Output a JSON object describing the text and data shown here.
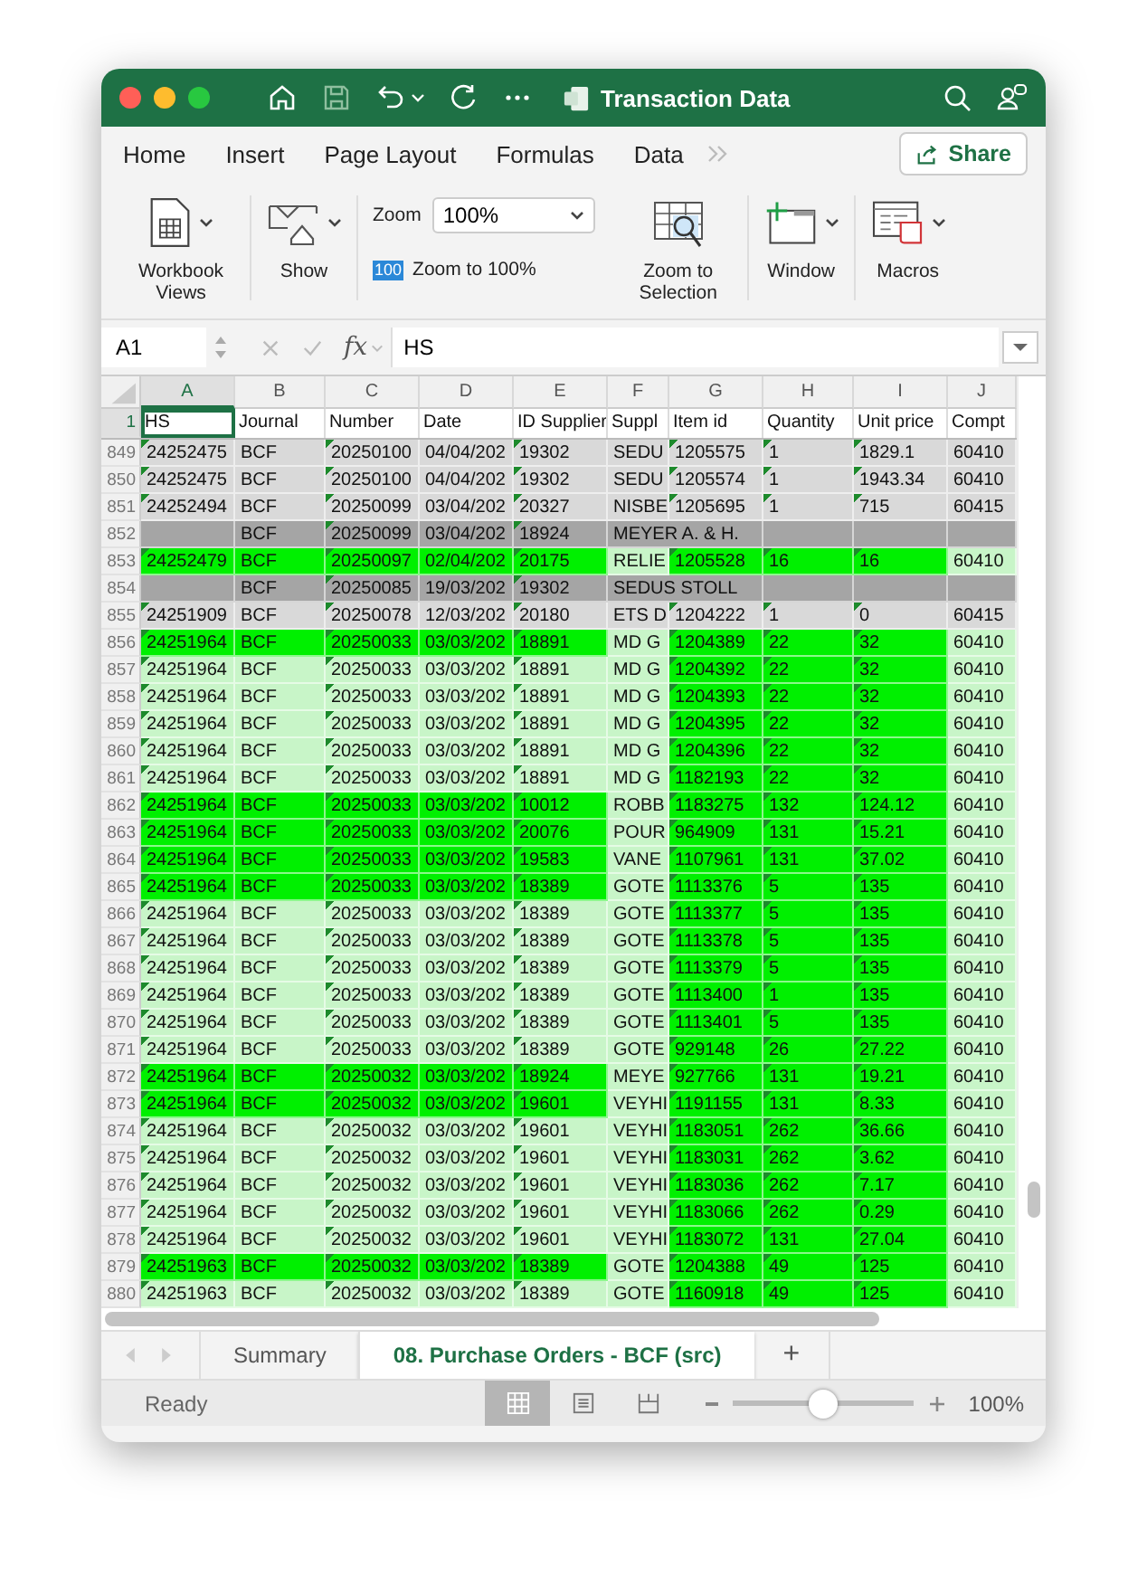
{
  "window": {
    "title": "Transaction Data"
  },
  "ribbon_tabs": [
    {
      "label": "Home"
    },
    {
      "label": "Insert"
    },
    {
      "label": "Page Layout"
    },
    {
      "label": "Formulas"
    },
    {
      "label": "Data"
    }
  ],
  "share_button": "Share",
  "ribbon": {
    "workbook_views": "Workbook Views",
    "show": "Show",
    "zoom_label": "Zoom",
    "zoom_value": "100%",
    "zoom_100_badge": "100",
    "zoom_100": "Zoom to 100%",
    "zoom_selection": "Zoom to Selection",
    "window": "Window",
    "macros": "Macros"
  },
  "formula_bar": {
    "name_box": "A1",
    "fx": "fx",
    "formula": "HS"
  },
  "columns": [
    {
      "letter": "A",
      "heading": "HS",
      "selected": true,
      "flagged": true
    },
    {
      "letter": "B",
      "heading": "Journal",
      "selected": false,
      "flagged": false
    },
    {
      "letter": "C",
      "heading": "Number",
      "selected": false,
      "flagged": true
    },
    {
      "letter": "D",
      "heading": "Date",
      "selected": false,
      "flagged": false
    },
    {
      "letter": "E",
      "heading": "ID Supplier",
      "selected": false,
      "flagged": true
    },
    {
      "letter": "F",
      "heading": "Suppl",
      "selected": false,
      "flagged": false
    },
    {
      "letter": "G",
      "heading": "Item id",
      "selected": false,
      "flagged": true
    },
    {
      "letter": "H",
      "heading": "Quantity",
      "selected": false,
      "flagged": true
    },
    {
      "letter": "I",
      "heading": "Unit price",
      "selected": false,
      "flagged": true
    },
    {
      "letter": "J",
      "heading": "Compt",
      "selected": false,
      "flagged": false
    }
  ],
  "header_row": {
    "number": "1",
    "selected": true
  },
  "rows": [
    {
      "number": "849",
      "kind": "gray",
      "cells": [
        "24252475",
        "BCF",
        "20250100",
        "04/04/202",
        "19302",
        "SEDU",
        "1205575",
        "1",
        "1829.1",
        "60410"
      ]
    },
    {
      "number": "850",
      "kind": "gray",
      "cells": [
        "24252475",
        "BCF",
        "20250100",
        "04/04/202",
        "19302",
        "SEDU",
        "1205574",
        "1",
        "1943.34",
        "60410"
      ]
    },
    {
      "number": "851",
      "kind": "gray",
      "cells": [
        "24252494",
        "BCF",
        "20250099",
        "03/04/202",
        "20327",
        "NISBE",
        "1205695",
        "1",
        "715",
        "60415"
      ]
    },
    {
      "number": "852",
      "kind": "dark",
      "cells": [
        null,
        "BCF",
        "20250099",
        "03/04/202",
        "18924",
        "MEYER A. & H.",
        null,
        null,
        null,
        null
      ]
    },
    {
      "number": "853",
      "kind": "bright",
      "cells": [
        "24252479",
        "BCF",
        "20250097",
        "02/04/202",
        "20175",
        "RELIE",
        "1205528",
        "16",
        "16",
        "60410"
      ]
    },
    {
      "number": "854",
      "kind": "dark",
      "cells": [
        null,
        "BCF",
        "20250085",
        "19/03/202",
        "19302",
        "SEDUS STOLL",
        null,
        null,
        null,
        null
      ]
    },
    {
      "number": "855",
      "kind": "gray",
      "cells": [
        "24251909",
        "BCF",
        "20250078",
        "12/03/202",
        "20180",
        "ETS D",
        "1204222",
        "1",
        "0",
        "60415"
      ]
    },
    {
      "number": "856",
      "kind": "bright",
      "cells": [
        "24251964",
        "BCF",
        "20250033",
        "03/03/202",
        "18891",
        "MD G",
        "1204389",
        "22",
        "32",
        "60410"
      ]
    },
    {
      "number": "857",
      "kind": "pale",
      "cells": [
        "24251964",
        "BCF",
        "20250033",
        "03/03/202",
        "18891",
        "MD G",
        "1204392",
        "22",
        "32",
        "60410"
      ]
    },
    {
      "number": "858",
      "kind": "pale",
      "cells": [
        "24251964",
        "BCF",
        "20250033",
        "03/03/202",
        "18891",
        "MD G",
        "1204393",
        "22",
        "32",
        "60410"
      ]
    },
    {
      "number": "859",
      "kind": "pale",
      "cells": [
        "24251964",
        "BCF",
        "20250033",
        "03/03/202",
        "18891",
        "MD G",
        "1204395",
        "22",
        "32",
        "60410"
      ]
    },
    {
      "number": "860",
      "kind": "pale",
      "cells": [
        "24251964",
        "BCF",
        "20250033",
        "03/03/202",
        "18891",
        "MD G",
        "1204396",
        "22",
        "32",
        "60410"
      ]
    },
    {
      "number": "861",
      "kind": "pale",
      "cells": [
        "24251964",
        "BCF",
        "20250033",
        "03/03/202",
        "18891",
        "MD G",
        "1182193",
        "22",
        "32",
        "60410"
      ]
    },
    {
      "number": "862",
      "kind": "bright",
      "cells": [
        "24251964",
        "BCF",
        "20250033",
        "03/03/202",
        "10012",
        "ROBB",
        "1183275",
        "132",
        "124.12",
        "60410"
      ]
    },
    {
      "number": "863",
      "kind": "bright",
      "cells": [
        "24251964",
        "BCF",
        "20250033",
        "03/03/202",
        "20076",
        "POUR",
        "964909",
        "131",
        "15.21",
        "60410"
      ]
    },
    {
      "number": "864",
      "kind": "bright",
      "cells": [
        "24251964",
        "BCF",
        "20250033",
        "03/03/202",
        "19583",
        "VANE",
        "1107961",
        "131",
        "37.02",
        "60410"
      ]
    },
    {
      "number": "865",
      "kind": "bright",
      "cells": [
        "24251964",
        "BCF",
        "20250033",
        "03/03/202",
        "18389",
        "GOTE",
        "1113376",
        "5",
        "135",
        "60410"
      ]
    },
    {
      "number": "866",
      "kind": "pale",
      "cells": [
        "24251964",
        "BCF",
        "20250033",
        "03/03/202",
        "18389",
        "GOTE",
        "1113377",
        "5",
        "135",
        "60410"
      ]
    },
    {
      "number": "867",
      "kind": "pale",
      "cells": [
        "24251964",
        "BCF",
        "20250033",
        "03/03/202",
        "18389",
        "GOTE",
        "1113378",
        "5",
        "135",
        "60410"
      ]
    },
    {
      "number": "868",
      "kind": "pale",
      "cells": [
        "24251964",
        "BCF",
        "20250033",
        "03/03/202",
        "18389",
        "GOTE",
        "1113379",
        "5",
        "135",
        "60410"
      ]
    },
    {
      "number": "869",
      "kind": "pale",
      "cells": [
        "24251964",
        "BCF",
        "20250033",
        "03/03/202",
        "18389",
        "GOTE",
        "1113400",
        "1",
        "135",
        "60410"
      ]
    },
    {
      "number": "870",
      "kind": "pale",
      "cells": [
        "24251964",
        "BCF",
        "20250033",
        "03/03/202",
        "18389",
        "GOTE",
        "1113401",
        "5",
        "135",
        "60410"
      ]
    },
    {
      "number": "871",
      "kind": "pale",
      "cells": [
        "24251964",
        "BCF",
        "20250033",
        "03/03/202",
        "18389",
        "GOTE",
        "929148",
        "26",
        "27.22",
        "60410"
      ]
    },
    {
      "number": "872",
      "kind": "bright",
      "cells": [
        "24251964",
        "BCF",
        "20250032",
        "03/03/202",
        "18924",
        "MEYE",
        "927766",
        "131",
        "19.21",
        "60410"
      ]
    },
    {
      "number": "873",
      "kind": "bright",
      "cells": [
        "24251964",
        "BCF",
        "20250032",
        "03/03/202",
        "19601",
        "VEYHI",
        "1191155",
        "131",
        "8.33",
        "60410"
      ]
    },
    {
      "number": "874",
      "kind": "pale",
      "cells": [
        "24251964",
        "BCF",
        "20250032",
        "03/03/202",
        "19601",
        "VEYHI",
        "1183051",
        "262",
        "36.66",
        "60410"
      ]
    },
    {
      "number": "875",
      "kind": "pale",
      "cells": [
        "24251964",
        "BCF",
        "20250032",
        "03/03/202",
        "19601",
        "VEYHI",
        "1183031",
        "262",
        "3.62",
        "60410"
      ]
    },
    {
      "number": "876",
      "kind": "pale",
      "cells": [
        "24251964",
        "BCF",
        "20250032",
        "03/03/202",
        "19601",
        "VEYHI",
        "1183036",
        "262",
        "7.17",
        "60410"
      ]
    },
    {
      "number": "877",
      "kind": "pale",
      "cells": [
        "24251964",
        "BCF",
        "20250032",
        "03/03/202",
        "19601",
        "VEYHI",
        "1183066",
        "262",
        "0.29",
        "60410"
      ]
    },
    {
      "number": "878",
      "kind": "pale",
      "cells": [
        "24251964",
        "BCF",
        "20250032",
        "03/03/202",
        "19601",
        "VEYHI",
        "1183072",
        "131",
        "27.04",
        "60410"
      ]
    },
    {
      "number": "879",
      "kind": "bright",
      "cells": [
        "24251963",
        "BCF",
        "20250032",
        "03/03/202",
        "18389",
        "GOTE",
        "1204388",
        "49",
        "125",
        "60410"
      ]
    },
    {
      "number": "880",
      "kind": "pale",
      "cells": [
        "24251963",
        "BCF",
        "20250032",
        "03/03/202",
        "18389",
        "GOTE",
        "1160918",
        "49",
        "125",
        "60410"
      ]
    }
  ],
  "sheet_tabs": [
    {
      "label": "Summary",
      "selected": false
    },
    {
      "label": "08. Purchase Orders - BCF (src)",
      "selected": true
    }
  ],
  "add_sheet": "+",
  "status_bar": {
    "status": "Ready",
    "views": [
      {
        "kind": "normal",
        "selected": true
      },
      {
        "kind": "page_layout",
        "selected": false
      },
      {
        "kind": "page_break",
        "selected": false
      }
    ],
    "zoom": {
      "level": 0.5
    },
    "zoom_reading": "100%"
  }
}
